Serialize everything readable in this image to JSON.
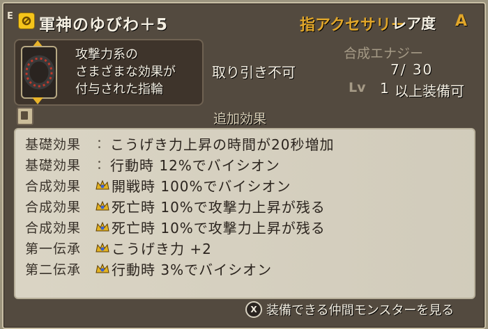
{
  "header": {
    "tag": "E",
    "item_name": "軍神のゆびわ＋5",
    "category": "指アクセサリー",
    "rarity_label": "レア度",
    "rarity_value": "A"
  },
  "description": {
    "lines": [
      "攻撃力系の",
      "さまざまな効果が",
      "付与された指輪"
    ]
  },
  "trade": "取り引き不可",
  "energy": {
    "label": "合成エナジー",
    "value": "7/ 30"
  },
  "level": {
    "label": "Lv",
    "value": "1",
    "suffix": "以上装備可"
  },
  "section_title": "追加効果",
  "effects": [
    {
      "label": "基礎効果",
      "marker": "colon",
      "text": "こうげき力上昇の時間が20秒増加"
    },
    {
      "label": "基礎効果",
      "marker": "colon",
      "text": "行動時 12%でバイシオン"
    },
    {
      "label": "合成効果",
      "marker": "crown",
      "text": "開戦時 100%でバイシオン"
    },
    {
      "label": "合成効果",
      "marker": "crown",
      "text": "死亡時 10%で攻撃力上昇が残る"
    },
    {
      "label": "合成効果",
      "marker": "crown",
      "text": "死亡時 10%で攻撃力上昇が残る"
    },
    {
      "label": "第一伝承",
      "marker": "crown",
      "text": "こうげき力 +2"
    },
    {
      "label": "第二伝承",
      "marker": "crown",
      "text": "行動時 3%でバイシオン"
    }
  ],
  "footer": {
    "button": "X",
    "text": "装備できる仲間モンスターを見る"
  },
  "colors": {
    "accent_gold": "#e0a62a",
    "panel": "#534a3f",
    "effects_bg": "#d8d2c1"
  }
}
